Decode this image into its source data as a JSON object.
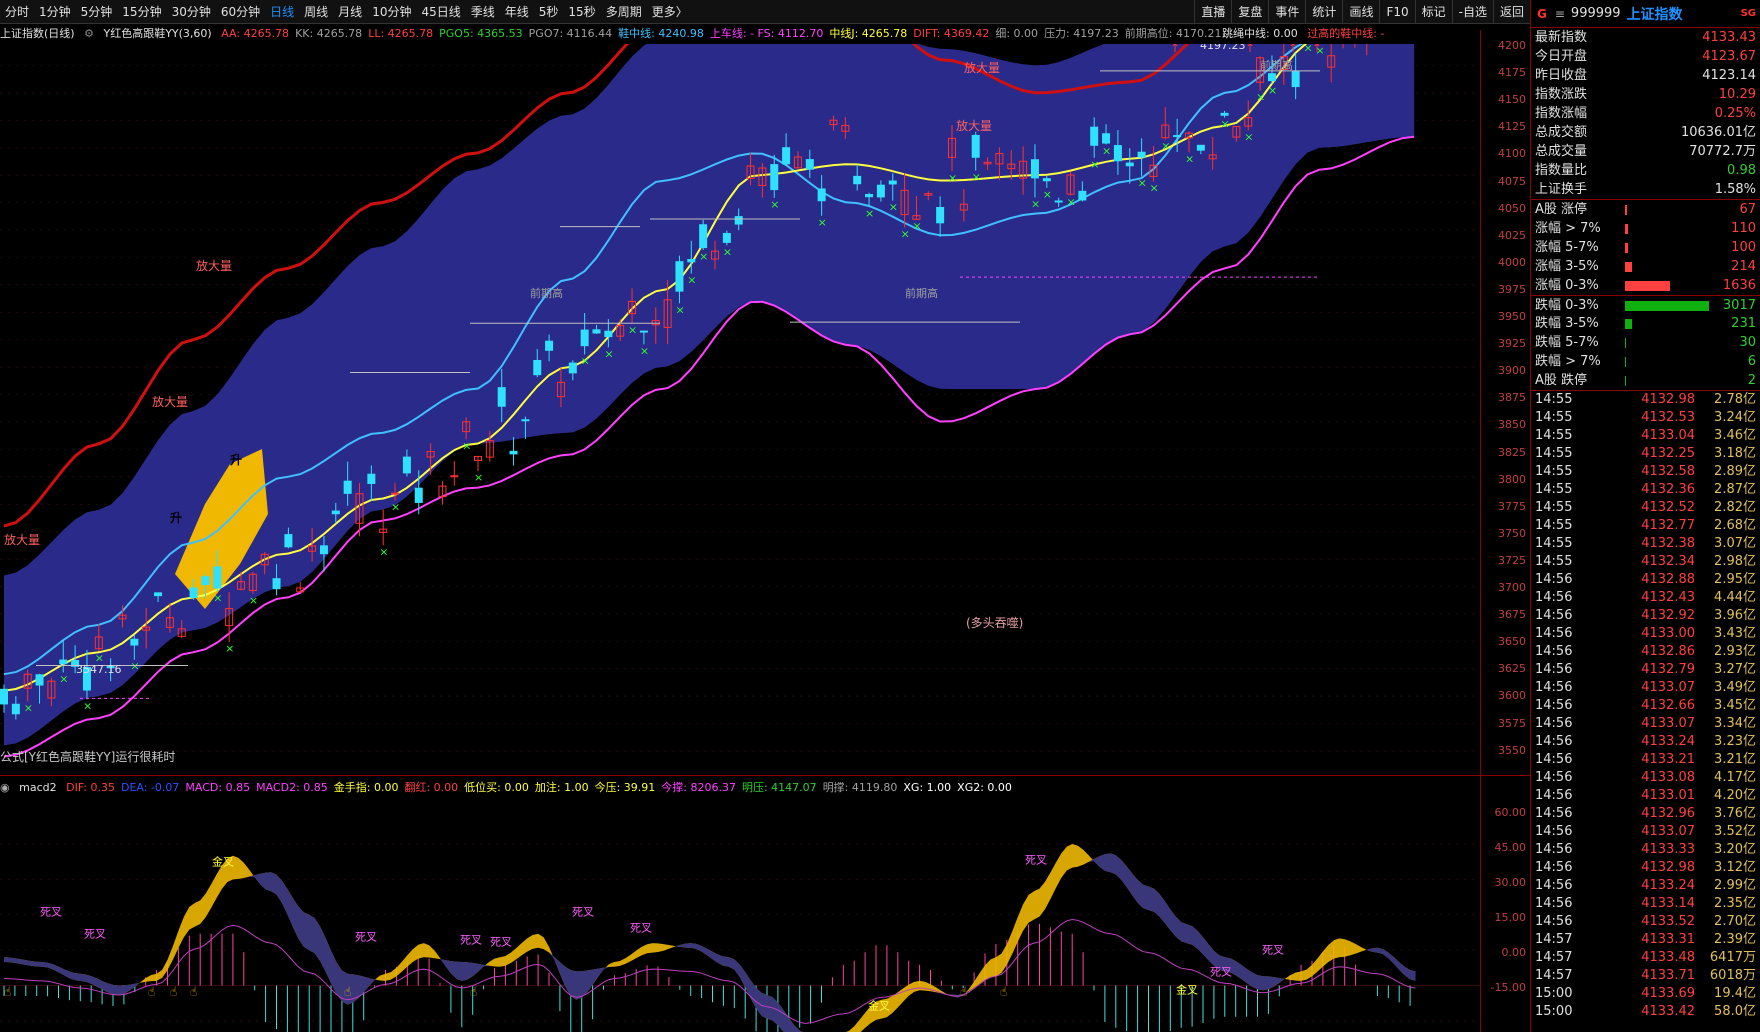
{
  "periods": [
    "分时",
    "1分钟",
    "5分钟",
    "15分钟",
    "30分钟",
    "60分钟",
    "日线",
    "周线",
    "月线",
    "10分钟",
    "45日线",
    "季线",
    "年线",
    "5秒",
    "15秒",
    "多周期",
    "更多〉"
  ],
  "active_period": "日线",
  "tools": [
    "直播",
    "复盘",
    "事件",
    "统计",
    "画线",
    "F10",
    "标记",
    "-自选",
    "返回"
  ],
  "legend": {
    "title": "上证指数(日线)",
    "indicator": "Y红色高跟鞋YY(3,60)",
    "items": [
      {
        "label": "AA: 4265.78",
        "color": "#ff4040"
      },
      {
        "label": "KK: 4265.78",
        "color": "#a0a0a0"
      },
      {
        "label": "LL: 4265.78",
        "color": "#ff4040"
      },
      {
        "label": "PGO5: 4365.53",
        "color": "#30d030"
      },
      {
        "label": "PGO7: 4116.44",
        "color": "#a0a0a0"
      },
      {
        "label": "鞋中线: 4240.98",
        "color": "#40c0ff"
      },
      {
        "label": "上车线: - FS: 4112.70",
        "color": "#ff40ff"
      },
      {
        "label": "中线J: 4265.78",
        "color": "#ffff40"
      },
      {
        "label": "DIFT: 4369.42",
        "color": "#ff4040"
      },
      {
        "label": "细: 0.00",
        "color": "#a0a0a0"
      },
      {
        "label": "压力: 4197.23",
        "color": "#a0a0a0"
      },
      {
        "label": "前期高位: 4170.21",
        "color": "#a0a0a0"
      }
    ],
    "extra": "跳绳中线: 0.00",
    "extra2": "过高的鞋中线: -"
  },
  "price_axis": [
    "4200",
    "4175",
    "4150",
    "4125",
    "4100",
    "4075",
    "4050",
    "4025",
    "4000",
    "3975",
    "3950",
    "3925",
    "3900",
    "3875",
    "3850",
    "3825",
    "3800",
    "3775",
    "3750",
    "3725",
    "3700",
    "3675",
    "3650",
    "3625",
    "3600",
    "3575",
    "3550"
  ],
  "chart_labels": {
    "high_marker": "4197.23",
    "low_marker": "3547.16",
    "volume_labels": [
      "放大量",
      "放大量",
      "放大量",
      "放大量",
      "放大量"
    ],
    "rise_labels": [
      "升",
      "升"
    ],
    "prior_high_labels": [
      "前期高",
      "前期高",
      "前期高"
    ],
    "bull_text": "(多头吞噬)",
    "formula_text": "公式[Y红色高跟鞋YY]运行很耗时"
  },
  "macd_legend": {
    "name": "macd2",
    "items": [
      {
        "label": "DIF: 0.35",
        "color": "#ff4040"
      },
      {
        "label": "DEA: -0.07",
        "color": "#3050ff"
      },
      {
        "label": "MACD: 0.85",
        "color": "#ff40ff"
      },
      {
        "label": "MACD2: 0.85",
        "color": "#ff40ff"
      },
      {
        "label": "金手指: 0.00",
        "color": "#ffff40"
      },
      {
        "label": "翻红: 0.00",
        "color": "#ff4040"
      },
      {
        "label": "低位买: 0.00",
        "color": "#ffff40"
      },
      {
        "label": "加注: 1.00",
        "color": "#ffff40"
      },
      {
        "label": "今压: 39.91",
        "color": "#ffff40"
      },
      {
        "label": "今撑: 8206.37",
        "color": "#ff40ff"
      },
      {
        "label": "明压: 4147.07",
        "color": "#30d030"
      },
      {
        "label": "明撑: 4119.80",
        "color": "#a0a0a0"
      },
      {
        "label": "XG: 1.00",
        "color": "#ffffff"
      },
      {
        "label": "XG2: 0.00",
        "color": "#ffffff"
      }
    ]
  },
  "macd_axis": [
    "60.00",
    "45.00",
    "30.00",
    "15.00",
    "0.00",
    "-15.00"
  ],
  "macd_labels": [
    "死叉",
    "死叉",
    "金叉",
    "死叉",
    "死叉",
    "死叉",
    "死叉",
    "死叉",
    "金叉",
    "死叉",
    "金叉",
    "死叉",
    "金叉",
    "死叉"
  ],
  "quote": {
    "code": "999999",
    "name": "上证指数",
    "badge": "SG",
    "rows": [
      {
        "k": "最新指数",
        "v": "4133.43",
        "c": "up"
      },
      {
        "k": "今日开盘",
        "v": "4123.67",
        "c": "up"
      },
      {
        "k": "昨日收盘",
        "v": "4123.14",
        "c": ""
      },
      {
        "k": "指数涨跌",
        "v": "10.29",
        "c": "up"
      },
      {
        "k": "指数涨幅",
        "v": "0.25%",
        "c": "up"
      },
      {
        "k": "总成交额",
        "v": "10636.01亿",
        "c": ""
      },
      {
        "k": "总成交量",
        "v": "70772.7万",
        "c": ""
      },
      {
        "k": "指数量比",
        "v": "0.98",
        "c": "down"
      },
      {
        "k": "上证换手",
        "v": "1.58%",
        "c": ""
      }
    ],
    "dist": [
      {
        "k": "A股 涨停",
        "v": "67",
        "bar": 2,
        "c": "up"
      },
      {
        "k": "涨幅 > 7%",
        "v": "110",
        "bar": 3,
        "c": "up"
      },
      {
        "k": "涨幅 5-7%",
        "v": "100",
        "bar": 3,
        "c": "up"
      },
      {
        "k": "涨幅 3-5%",
        "v": "214",
        "bar": 7,
        "c": "up"
      },
      {
        "k": "涨幅 0-3%",
        "v": "1636",
        "bar": 45,
        "c": "up"
      },
      {
        "k": "跌幅 0-3%",
        "v": "3017",
        "bar": 84,
        "c": "down"
      },
      {
        "k": "跌幅 3-5%",
        "v": "231",
        "bar": 7,
        "c": "down"
      },
      {
        "k": "跌幅 5-7%",
        "v": "30",
        "bar": 1,
        "c": "down"
      },
      {
        "k": "跌幅 > 7%",
        "v": "6",
        "bar": 1,
        "c": "down"
      },
      {
        "k": "A股 跌停",
        "v": "2",
        "bar": 1,
        "c": "down"
      }
    ],
    "ticks": [
      {
        "t": "14:55",
        "p": "4132.98",
        "v": "2.78亿"
      },
      {
        "t": "14:55",
        "p": "4132.53",
        "v": "3.24亿"
      },
      {
        "t": "14:55",
        "p": "4133.04",
        "v": "3.46亿"
      },
      {
        "t": "14:55",
        "p": "4132.25",
        "v": "3.18亿"
      },
      {
        "t": "14:55",
        "p": "4132.58",
        "v": "2.89亿"
      },
      {
        "t": "14:55",
        "p": "4132.36",
        "v": "2.87亿"
      },
      {
        "t": "14:55",
        "p": "4132.52",
        "v": "2.82亿"
      },
      {
        "t": "14:55",
        "p": "4132.77",
        "v": "2.68亿"
      },
      {
        "t": "14:55",
        "p": "4132.38",
        "v": "3.07亿"
      },
      {
        "t": "14:55",
        "p": "4132.34",
        "v": "2.98亿"
      },
      {
        "t": "14:56",
        "p": "4132.88",
        "v": "2.95亿"
      },
      {
        "t": "14:56",
        "p": "4132.43",
        "v": "4.44亿"
      },
      {
        "t": "14:56",
        "p": "4132.92",
        "v": "3.96亿"
      },
      {
        "t": "14:56",
        "p": "4133.00",
        "v": "3.43亿"
      },
      {
        "t": "14:56",
        "p": "4132.86",
        "v": "2.93亿"
      },
      {
        "t": "14:56",
        "p": "4132.79",
        "v": "3.27亿"
      },
      {
        "t": "14:56",
        "p": "4133.07",
        "v": "3.49亿"
      },
      {
        "t": "14:56",
        "p": "4132.66",
        "v": "3.45亿"
      },
      {
        "t": "14:56",
        "p": "4133.07",
        "v": "3.34亿"
      },
      {
        "t": "14:56",
        "p": "4133.24",
        "v": "3.23亿"
      },
      {
        "t": "14:56",
        "p": "4133.21",
        "v": "3.21亿"
      },
      {
        "t": "14:56",
        "p": "4133.08",
        "v": "4.17亿"
      },
      {
        "t": "14:56",
        "p": "4133.01",
        "v": "4.20亿"
      },
      {
        "t": "14:56",
        "p": "4132.96",
        "v": "3.76亿"
      },
      {
        "t": "14:56",
        "p": "4133.07",
        "v": "3.52亿"
      },
      {
        "t": "14:56",
        "p": "4133.33",
        "v": "3.20亿"
      },
      {
        "t": "14:56",
        "p": "4132.98",
        "v": "3.12亿"
      },
      {
        "t": "14:56",
        "p": "4133.24",
        "v": "2.99亿"
      },
      {
        "t": "14:56",
        "p": "4133.14",
        "v": "2.35亿"
      },
      {
        "t": "14:56",
        "p": "4133.52",
        "v": "2.70亿"
      },
      {
        "t": "14:57",
        "p": "4133.31",
        "v": "2.39亿"
      },
      {
        "t": "14:57",
        "p": "4133.48",
        "v": "6417万"
      },
      {
        "t": "14:57",
        "p": "4133.71",
        "v": "6018万"
      },
      {
        "t": "15:00",
        "p": "4133.69",
        "v": "19.4亿"
      },
      {
        "t": "15:00",
        "p": "4133.42",
        "v": "58.0亿"
      }
    ]
  },
  "colors": {
    "up": "#ff4040",
    "down": "#30d030",
    "band": "#2a2a8a",
    "mid": "#ffff40",
    "shoe": "#40c0ff",
    "stop": "#ff40ff",
    "upper": "#d01010",
    "accent": "#1e90ff"
  }
}
